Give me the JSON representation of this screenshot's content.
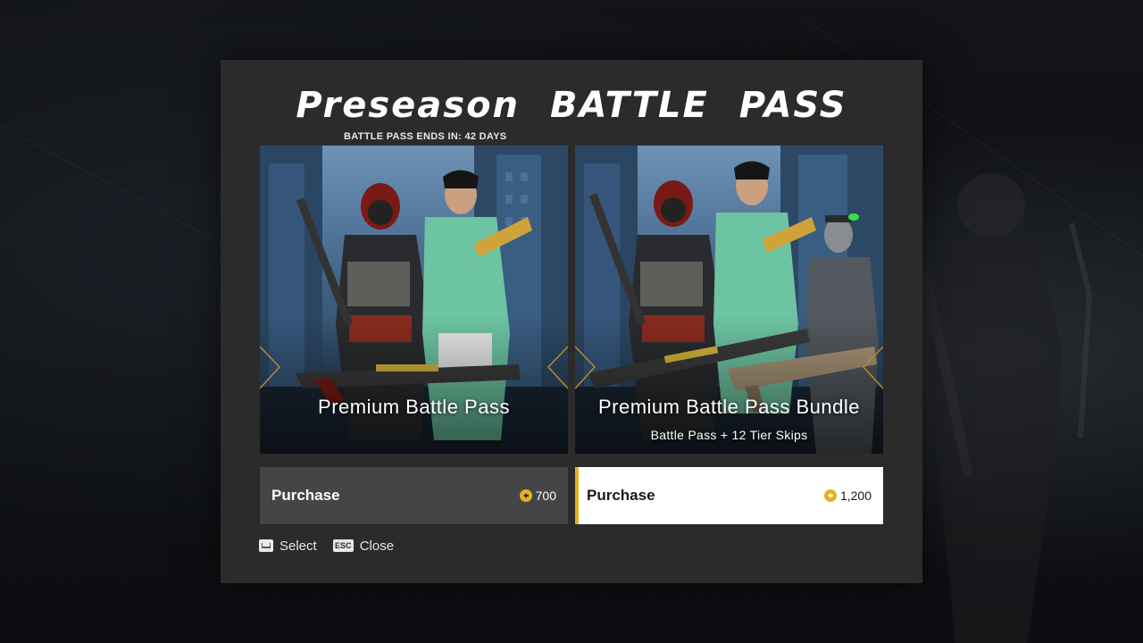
{
  "modal": {
    "title": "Preseason  BATTLE PASS",
    "subtitle": "BATTLE PASS ENDS IN: 42 DAYS"
  },
  "offers": [
    {
      "title": "Premium Battle Pass",
      "subtitle": "",
      "purchase_label": "Purchase",
      "price": "700",
      "currency_icon": "coin-icon",
      "selected": false
    },
    {
      "title": "Premium Battle Pass Bundle",
      "subtitle": "Battle Pass + 12 Tier Skips",
      "purchase_label": "Purchase",
      "price": "1,200",
      "currency_icon": "coin-icon",
      "selected": true
    }
  ],
  "hints": {
    "select_key": "space-key-icon",
    "select_label": "Select",
    "close_key": "ESC",
    "close_label": "Close"
  },
  "colors": {
    "accent": "#e3b21f",
    "modal_bg": "#2b2b2c",
    "button_bg": "#454546",
    "selected_bg": "#ffffff"
  }
}
